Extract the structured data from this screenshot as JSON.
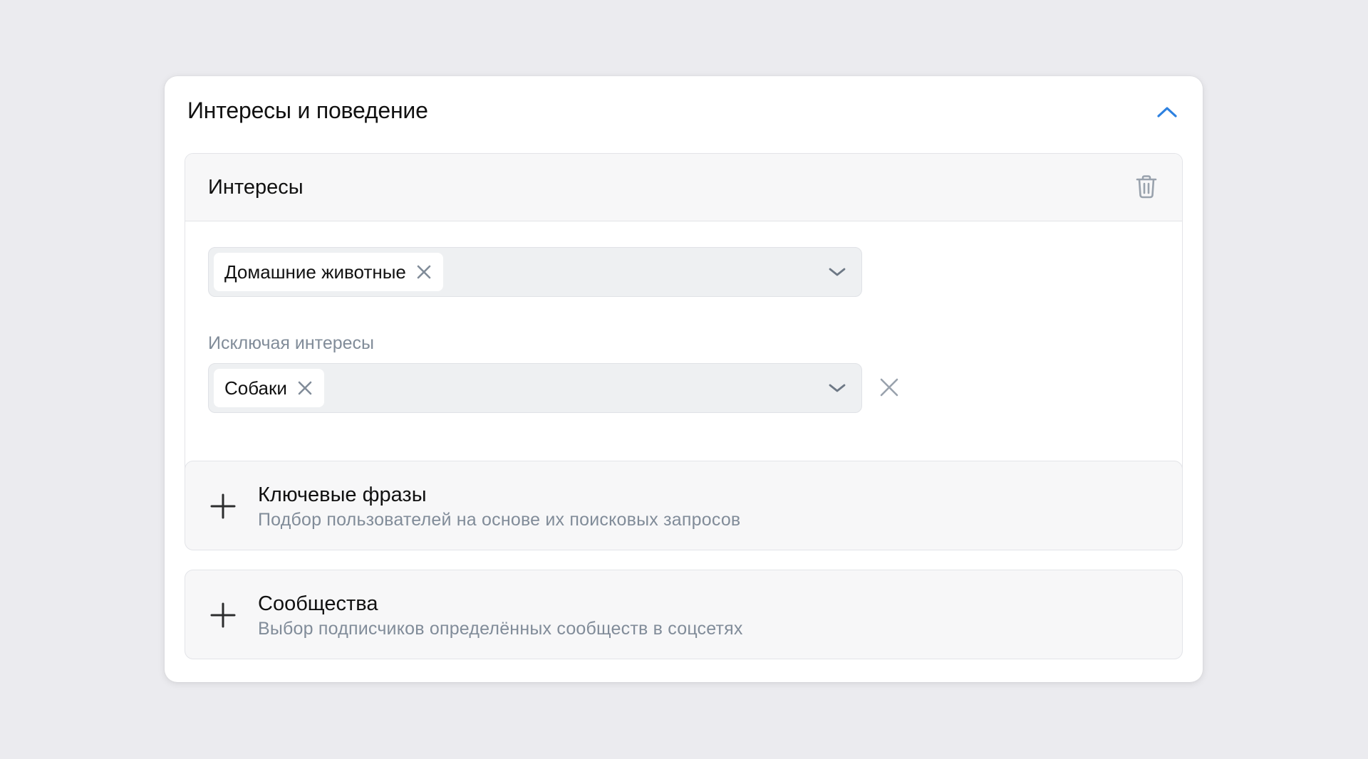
{
  "panel": {
    "title": "Интересы и поведение",
    "collapse_icon": "chevron-up-icon",
    "accent_color": "#2d81e0"
  },
  "interests": {
    "title": "Интересы",
    "delete_icon": "trash-icon",
    "included": {
      "chips": [
        {
          "label": "Домашние животные"
        }
      ]
    },
    "excluded": {
      "label": "Исключая интересы",
      "chips": [
        {
          "label": "Собаки"
        }
      ]
    }
  },
  "add_sections": [
    {
      "title": "Ключевые фразы",
      "description": "Подбор пользователей на основе их поисковых запросов",
      "icon": "plus-icon"
    },
    {
      "title": "Сообщества",
      "description": "Выбор подписчиков определённых сообществ в соцсетях",
      "icon": "plus-icon"
    }
  ]
}
